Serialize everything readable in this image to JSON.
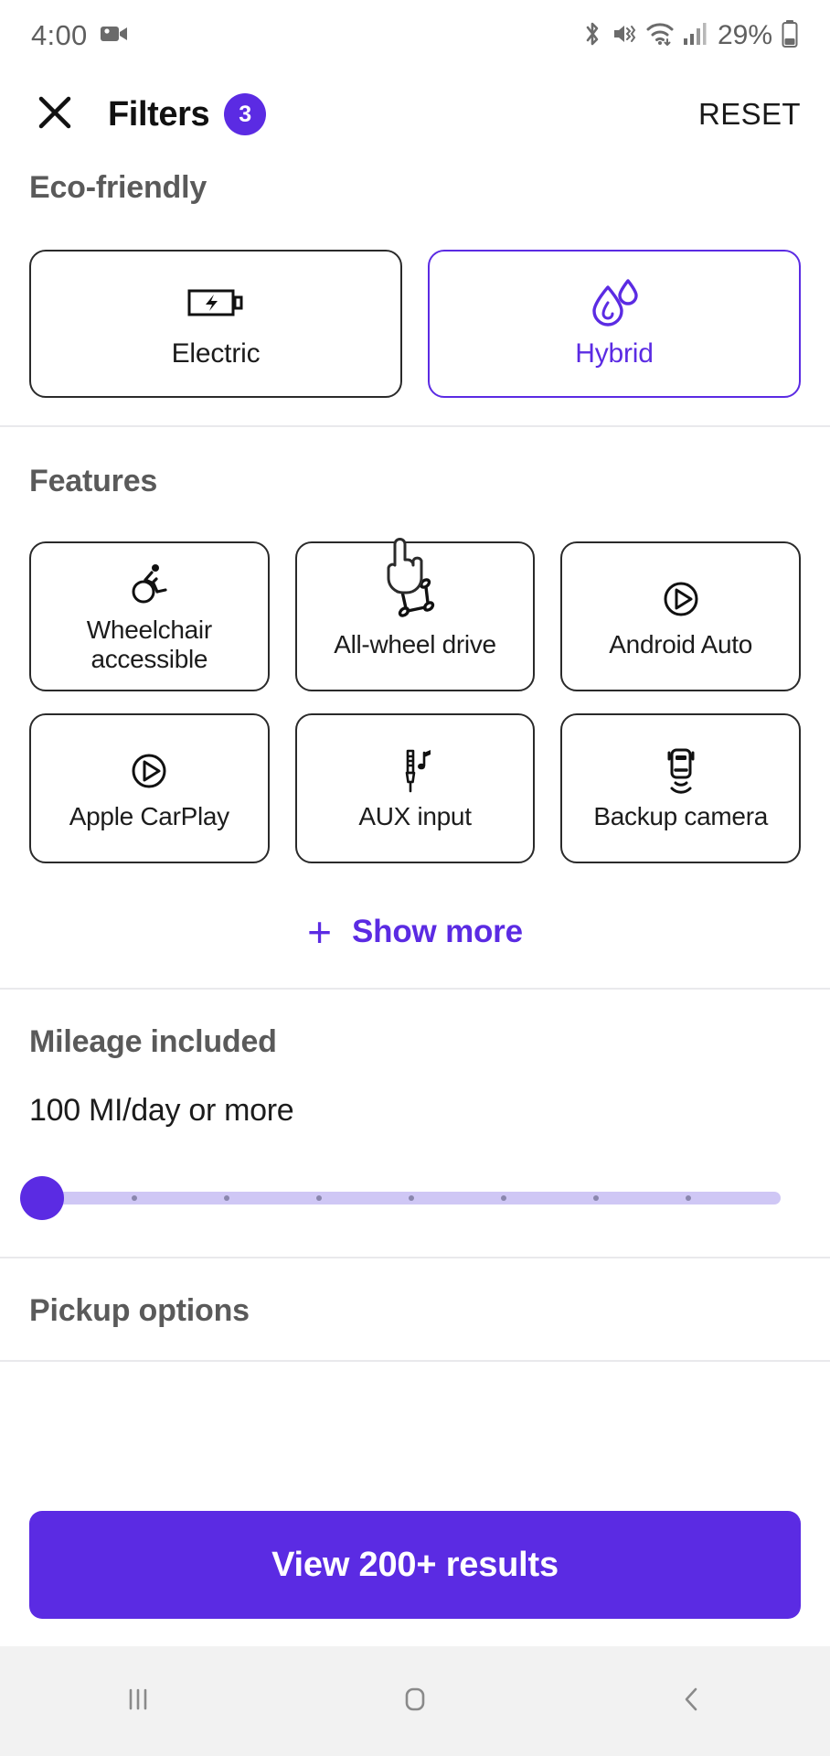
{
  "status_bar": {
    "time": "4:00",
    "battery_percent": "29%",
    "icons": [
      "video-camera-icon",
      "bluetooth-icon",
      "mute-vibrate-icon",
      "wifi-icon",
      "cellular-signal-icon",
      "battery-icon"
    ]
  },
  "header": {
    "close_icon": "close-icon",
    "title": "Filters",
    "badge_count": "3",
    "reset_label": "RESET"
  },
  "eco_friendly": {
    "title": "Eco-friendly",
    "options": [
      {
        "label": "Electric",
        "icon": "battery-charging-icon",
        "selected": false
      },
      {
        "label": "Hybrid",
        "icon": "water-drops-icon",
        "selected": true
      }
    ]
  },
  "features": {
    "title": "Features",
    "items": [
      {
        "label": "Wheelchair\naccessible",
        "icon": "wheelchair-icon",
        "selected": false
      },
      {
        "label": "All-wheel drive",
        "icon": "all-wheel-drive-icon",
        "selected": false
      },
      {
        "label": "Android Auto",
        "icon": "play-circle-icon",
        "selected": false
      },
      {
        "label": "Apple CarPlay",
        "icon": "play-circle-icon",
        "selected": false
      },
      {
        "label": "AUX input",
        "icon": "aux-jack-music-icon",
        "selected": false
      },
      {
        "label": "Backup camera",
        "icon": "backup-camera-icon",
        "selected": false
      }
    ],
    "show_more_label": "Show more",
    "show_more_icon": "plus-icon"
  },
  "mileage": {
    "title": "Mileage included",
    "value_label": "100 MI/day or more",
    "slider_position_percent": 0,
    "tick_count": 7
  },
  "pickup": {
    "title": "Pickup options"
  },
  "footer": {
    "cta_label": "View 200+ results"
  },
  "nav_bar": {
    "recents_icon": "recents-icon",
    "home_icon": "home-icon",
    "back_icon": "back-icon"
  },
  "colors": {
    "accent": "#5B2BE3",
    "track": "#cfc7f5",
    "text": "#1c1c1c",
    "section_title": "#5a5a5a",
    "border": "#2a2a2a"
  }
}
